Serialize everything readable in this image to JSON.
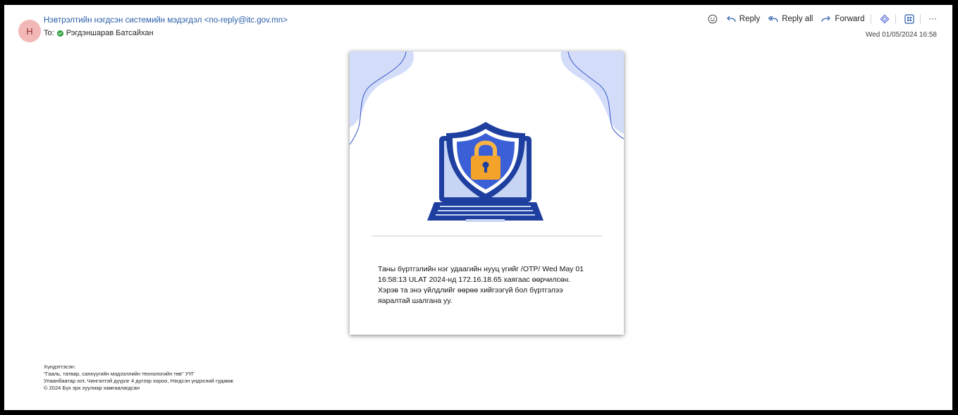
{
  "header": {
    "avatar_initial": "Н",
    "sender": "Нэвтрэлтийн нэгдсэн системийн мэдэгдэл <no-reply@itc.gov.mn>",
    "to_label": "To:",
    "recipient": "Рэгдэншарав Батсайхан",
    "date": "Wed 01/05/2024 16:58"
  },
  "toolbar": {
    "emoji_icon": "smiley-icon",
    "reply_label": "Reply",
    "reply_all_label": "Reply all",
    "forward_label": "Forward",
    "more_label": "···"
  },
  "card": {
    "message_lines": [
      "Таны бүртгэлийн нэг удаагийн нууц үгийг /OTP/ Wed May 01",
      "16:58:13 ULAT 2024-нд 172.16.18.65 хаягаас өөрчилсөн.",
      "Хэрэв та энэ үйлдлийг өөрөө хийгээгүй бол бүртгэлээ",
      "яаралтай шалгана уу."
    ]
  },
  "footer": {
    "lines": [
      "Хүндэтгэсэн:",
      "\"Гааль, татвар, санхүүгийн мэдээллийн технологийн төв\" УҮГ",
      "Улаанбаатар хот, Чингэлтэй дүүрэг 4 дүгээр хороо, Нэгдсэн үндэсний гудамж",
      "© 2024 Бүх эрх хуулиар хамгаалагдсан"
    ]
  },
  "colors": {
    "accent": "#2a5da8",
    "shield": "#1e3fa0",
    "lock": "#f3a32a",
    "screen": "#c7d4f3",
    "blob": "#d3ddfa"
  }
}
